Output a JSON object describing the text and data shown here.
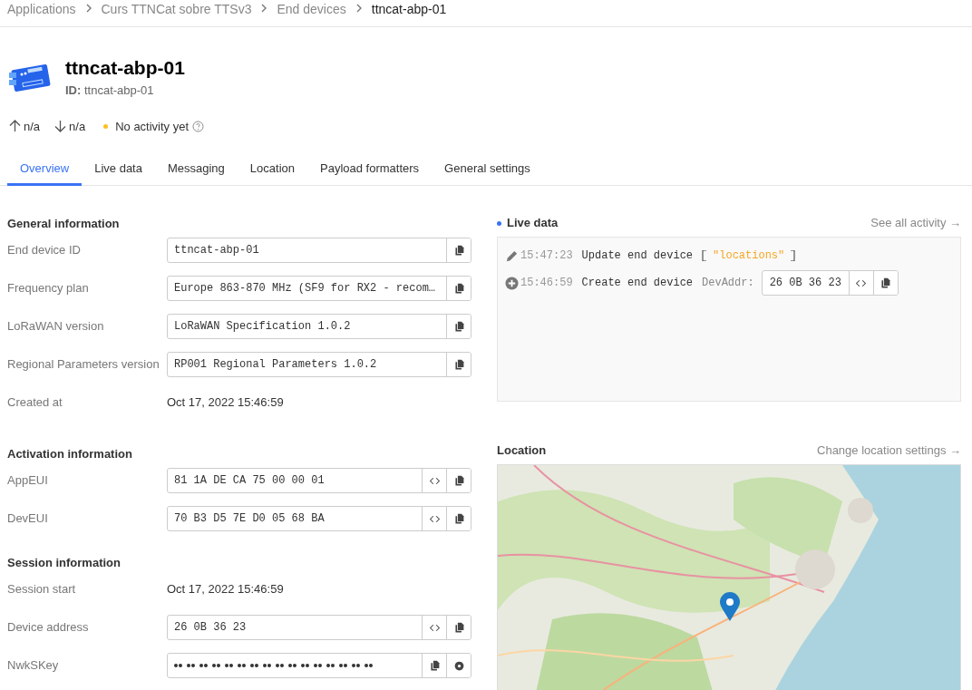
{
  "breadcrumbs": [
    {
      "label": "Applications",
      "current": false
    },
    {
      "label": "Curs TTNCat sobre TTSv3",
      "current": false
    },
    {
      "label": "End devices",
      "current": false
    },
    {
      "label": "ttncat-abp-01",
      "current": true
    }
  ],
  "device": {
    "name": "ttncat-abp-01",
    "id_label": "ID:",
    "id": "ttncat-abp-01"
  },
  "status": {
    "uplink": "n/a",
    "downlink": "n/a",
    "activity": "No activity yet"
  },
  "tabs": [
    {
      "label": "Overview",
      "selected": true
    },
    {
      "label": "Live data",
      "selected": false
    },
    {
      "label": "Messaging",
      "selected": false
    },
    {
      "label": "Location",
      "selected": false
    },
    {
      "label": "Payload formatters",
      "selected": false
    },
    {
      "label": "General settings",
      "selected": false
    }
  ],
  "sections": [
    {
      "title": "General information",
      "rows": [
        {
          "label": "End device ID",
          "kind": "field",
          "value": "ttncat-abp-01",
          "format_button": false
        },
        {
          "label": "Frequency plan",
          "kind": "field",
          "value": "Europe 863-870 MHz (SF9 for RX2 - recom…",
          "format_button": false
        },
        {
          "label": "LoRaWAN version",
          "kind": "field",
          "value": "LoRaWAN Specification 1.0.2",
          "format_button": false
        },
        {
          "label": "Regional Parameters version",
          "kind": "field",
          "value": "RP001 Regional Parameters 1.0.2",
          "format_button": false
        },
        {
          "label": "Created at",
          "kind": "text",
          "value": "Oct 17, 2022 15:46:59"
        }
      ]
    },
    {
      "title": "Activation information",
      "rows": [
        {
          "label": "AppEUI",
          "kind": "field",
          "value": "81 1A DE CA 75 00 00 01",
          "format_button": true
        },
        {
          "label": "DevEUI",
          "kind": "field",
          "value": "70 B3 D5 7E D0 05 68 BA",
          "format_button": true
        }
      ]
    },
    {
      "title": "Session information",
      "rows": [
        {
          "label": "Session start",
          "kind": "text",
          "value": "Oct 17, 2022 15:46:59"
        },
        {
          "label": "Device address",
          "kind": "field",
          "value": "26 0B 36 23",
          "format_button": true
        },
        {
          "label": "NwkSKey",
          "kind": "secret"
        }
      ]
    }
  ],
  "live_data": {
    "title": "Live data",
    "link": "See all activity →",
    "events": [
      {
        "kind": "update",
        "time": "15:47:23",
        "text": "Update end device",
        "detail": "\"locations\""
      },
      {
        "kind": "create",
        "time": "15:46:59",
        "text": "Create end device",
        "field_label": "DevAddr:",
        "field_value": "26 0B 36 23"
      }
    ]
  },
  "location": {
    "title": "Location",
    "link": "Change location settings →"
  }
}
